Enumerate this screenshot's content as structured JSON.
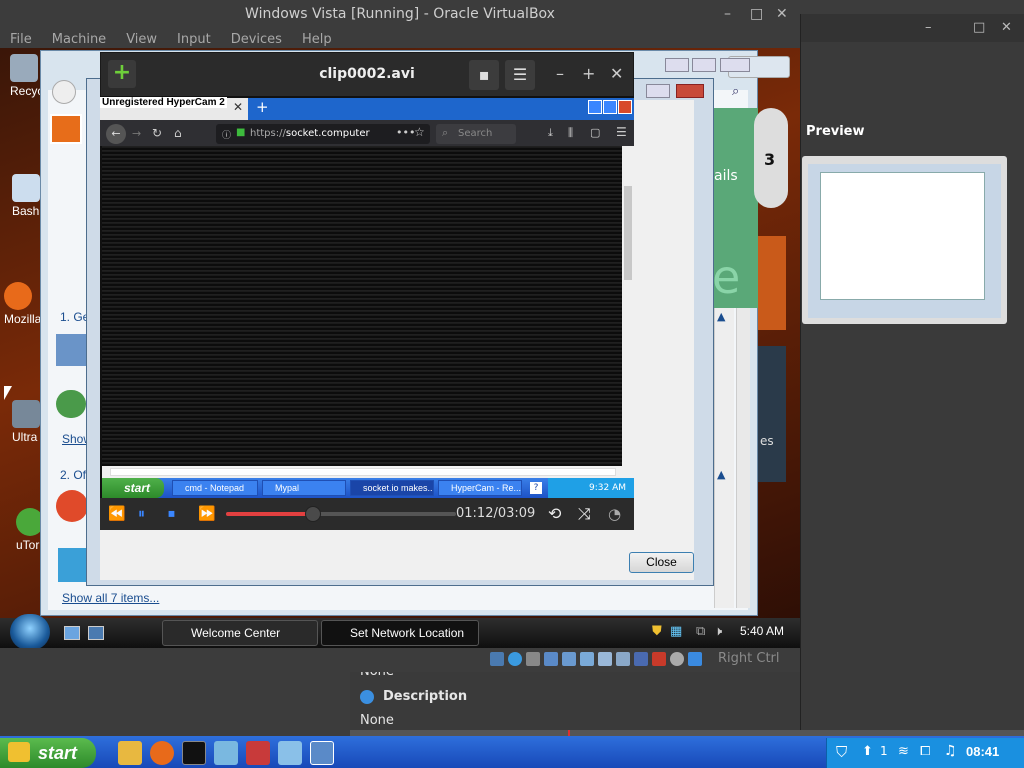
{
  "vbox": {
    "title": "Windows Vista [Running] - Oracle VirtualBox",
    "menu": [
      "File",
      "Machine",
      "View",
      "Input",
      "Devices",
      "Help"
    ],
    "right_ctrl": "Right Ctrl"
  },
  "manager": {
    "preview_label": "Preview",
    "lower_value_1": "None",
    "description_label": "Description",
    "lower_value_2": "None"
  },
  "vista_desktop": {
    "icons": [
      "Recyc",
      "Bash Ultra",
      "Mozilla",
      "Ultra Fi",
      "uTor"
    ]
  },
  "welcome_center": {
    "item_1": "1. Ge",
    "show_link": "Show",
    "item_2": "2. Of",
    "show_all": "Show all 7 items...",
    "side_text_1": "ails",
    "side_text_2": "e",
    "side_text_3": "es"
  },
  "net_dialog": {
    "close_label": "Close"
  },
  "player": {
    "title": "clip0002.avi",
    "timecode": "01:12/03:09",
    "progress_fraction": 0.38
  },
  "recorded": {
    "watermark": "Unregistered HyperCam 2",
    "url_prefix": "https://",
    "url_host": "socket.computer",
    "search_placeholder": "Search",
    "xp_start": "start",
    "xp_tasks": [
      "cmd - Notepad",
      "Mypal",
      "socket.io makes...",
      "HyperCam - Re..."
    ],
    "xp_clock": "9:32 AM"
  },
  "vista_taskbar": {
    "tasks": [
      "Welcome Center",
      "Set Network Location"
    ],
    "clock": "5:40 AM"
  },
  "host_taskbar": {
    "start": "start",
    "clock": "08:41",
    "tray_count": "1"
  }
}
